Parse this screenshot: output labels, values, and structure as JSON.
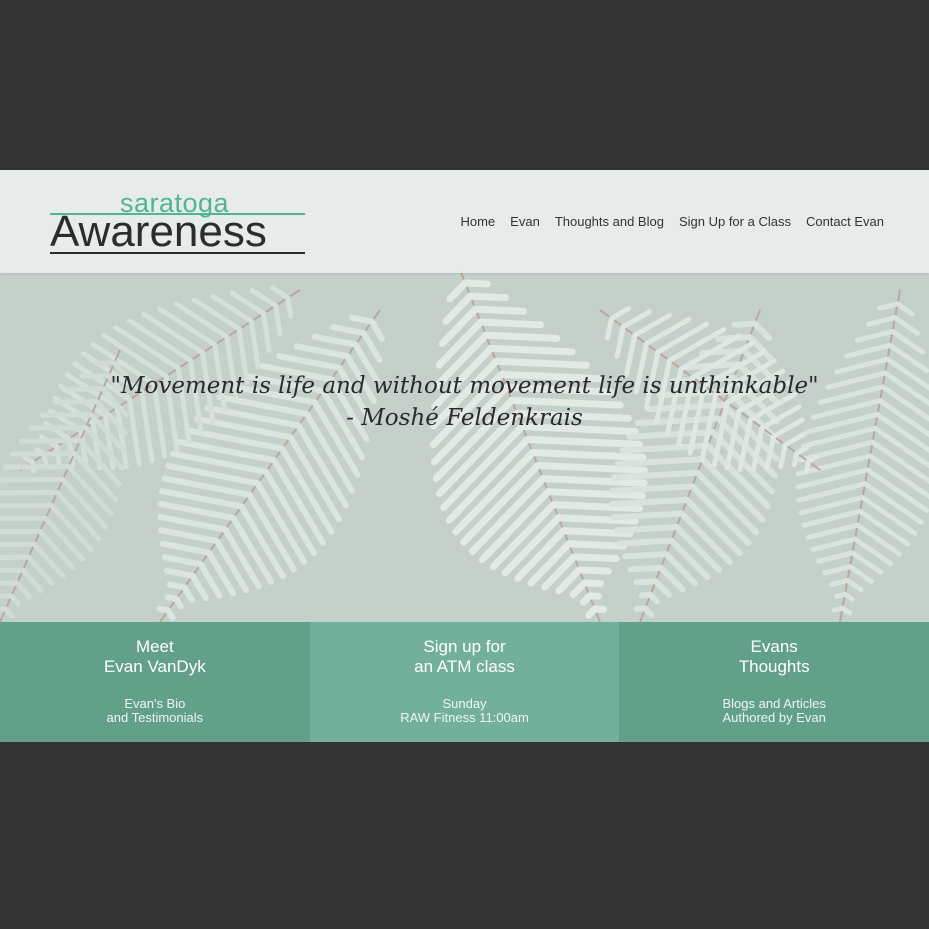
{
  "logo": {
    "top": "saratoga",
    "bottom": "Awareness"
  },
  "nav": [
    {
      "label": "Home"
    },
    {
      "label": "Evan"
    },
    {
      "label": "Thoughts and Blog"
    },
    {
      "label": "Sign Up for a Class"
    },
    {
      "label": "Contact Evan"
    }
  ],
  "hero": {
    "quote_line1": "\"Movement is life and without movement life is unthinkable\"",
    "quote_line2": "- Moshé Feldenkrais"
  },
  "boxes": [
    {
      "title1": "Meet",
      "title2": "Evan VanDyk",
      "sub1": "Evan's Bio",
      "sub2": "and Testimonials"
    },
    {
      "title1": "Sign up for",
      "title2": "an ATM class",
      "sub1": "Sunday",
      "sub2": "RAW Fitness 11:00am"
    },
    {
      "title1": "Evans",
      "title2": "Thoughts",
      "sub1": "Blogs and Articles",
      "sub2": "Authored by Evan"
    }
  ],
  "colors": {
    "accent": "#4fb595",
    "box": "#62a08a",
    "box_alt": "#72b09b",
    "frame": "#333333"
  }
}
